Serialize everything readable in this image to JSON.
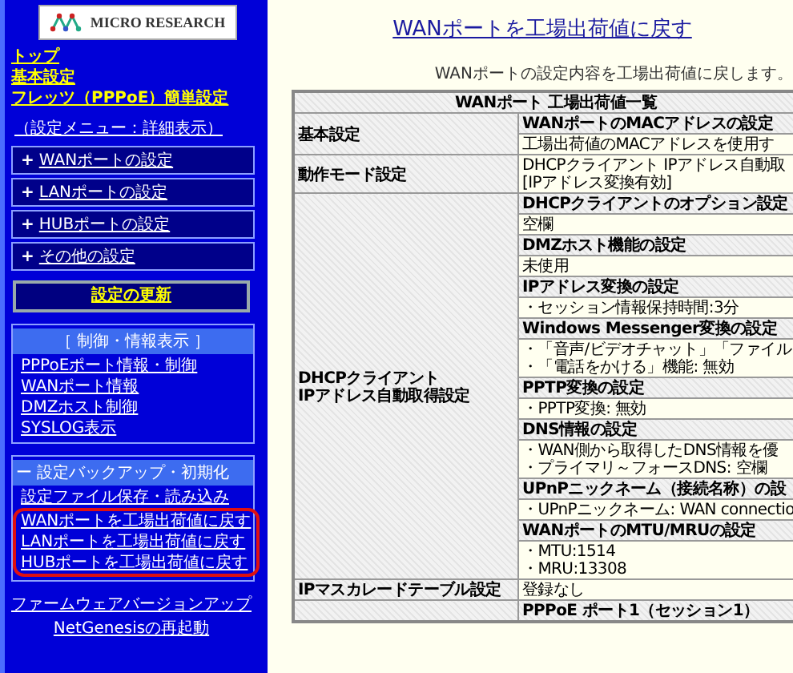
{
  "sidebar": {
    "logo": {
      "text": "MICRO RESEARCH"
    },
    "top_links": [
      "トップ",
      "基本設定",
      "フレッツ（PPPoE）簡単設定"
    ],
    "menu_mode_link": "（設定メニュー：詳細表示）",
    "menu_groups": [
      {
        "icon": "+",
        "label": "WANポートの設定"
      },
      {
        "icon": "+",
        "label": "LANポートの設定"
      },
      {
        "icon": "+",
        "label": "HUBポートの設定"
      },
      {
        "icon": "+",
        "label": "その他の設定"
      }
    ],
    "update_button": "設定の更新",
    "info_section": {
      "title": "［ 制御・情報表示 ］",
      "links": [
        "PPPoEポート情報・制御",
        "WANポート情報",
        "DMZホスト制御",
        "SYSLOG表示"
      ]
    },
    "backup_section": {
      "title": "ー 設定バックアップ・初期化",
      "links": [
        {
          "text": "設定ファイル保存・読み込み",
          "highlighted": false
        },
        {
          "text": "WANポートを工場出荷値に戻す",
          "highlighted": true
        },
        {
          "text": "LANポートを工場出荷値に戻す",
          "highlighted": true
        },
        {
          "text": "HUBポートを工場出荷値に戻す",
          "highlighted": true
        }
      ]
    },
    "bottom_links": [
      "ファームウェアバージョンアップ",
      "NetGenesisの再起動"
    ]
  },
  "page_title": "WANポートを工場出荷値に戻す",
  "description": "WANポートの設定内容を工場出荷値に戻します。",
  "table": {
    "title": "WANポート 工場出荷値一覧",
    "groups": [
      {
        "label": [
          "基本設定"
        ],
        "entries": [
          {
            "kind": "heading",
            "lines": [
              "WANポートのMACアドレスの設定"
            ]
          },
          {
            "kind": "value",
            "lines": [
              "工場出荷値のMACアドレスを使用す"
            ]
          }
        ]
      },
      {
        "label": [
          "動作モード設定"
        ],
        "entries": [
          {
            "kind": "value",
            "lines": [
              "DHCPクライアント IPアドレス自動取",
              "[IPアドレス変換有効]"
            ]
          }
        ]
      },
      {
        "label": [
          "DHCPクライアント",
          "IPアドレス自動取得設定"
        ],
        "entries": [
          {
            "kind": "heading",
            "lines": [
              "DHCPクライアントのオプション設定"
            ]
          },
          {
            "kind": "value",
            "lines": [
              "空欄"
            ]
          },
          {
            "kind": "heading",
            "lines": [
              "DMZホスト機能の設定"
            ]
          },
          {
            "kind": "value",
            "lines": [
              "未使用"
            ]
          },
          {
            "kind": "heading",
            "lines": [
              "IPアドレス変換の設定"
            ]
          },
          {
            "kind": "value",
            "lines": [
              "・セッション情報保持時間:3分"
            ]
          },
          {
            "kind": "heading",
            "lines": [
              "Windows Messenger変換の設定"
            ]
          },
          {
            "kind": "value",
            "lines": [
              "・「音声/ビデオチャット」「ファイル",
              "・「電話をかける」機能: 無効"
            ]
          },
          {
            "kind": "heading",
            "lines": [
              "PPTP変換の設定"
            ]
          },
          {
            "kind": "value",
            "lines": [
              "・PPTP変換: 無効"
            ]
          },
          {
            "kind": "heading",
            "lines": [
              "DNS情報の設定"
            ]
          },
          {
            "kind": "value",
            "lines": [
              "・WAN側から取得したDNS情報を優",
              "・プライマリ～フォースDNS: 空欄"
            ]
          },
          {
            "kind": "heading",
            "lines": [
              "UPnPニックネーム（接続名称）の設"
            ]
          },
          {
            "kind": "value",
            "lines": [
              "・UPnPニックネーム: WAN connectio"
            ]
          },
          {
            "kind": "heading",
            "lines": [
              "WANポートのMTU/MRUの設定"
            ]
          },
          {
            "kind": "value",
            "lines": [
              "・MTU:1514",
              "・MRU:13308"
            ]
          }
        ]
      },
      {
        "label": [
          "IPマスカレードテーブル設定"
        ],
        "entries": [
          {
            "kind": "value",
            "lines": [
              "登録なし"
            ]
          }
        ]
      },
      {
        "entries": [
          {
            "kind": "heading",
            "lines": [
              "PPPoE ポート1（セッション1）"
            ]
          }
        ]
      }
    ]
  }
}
